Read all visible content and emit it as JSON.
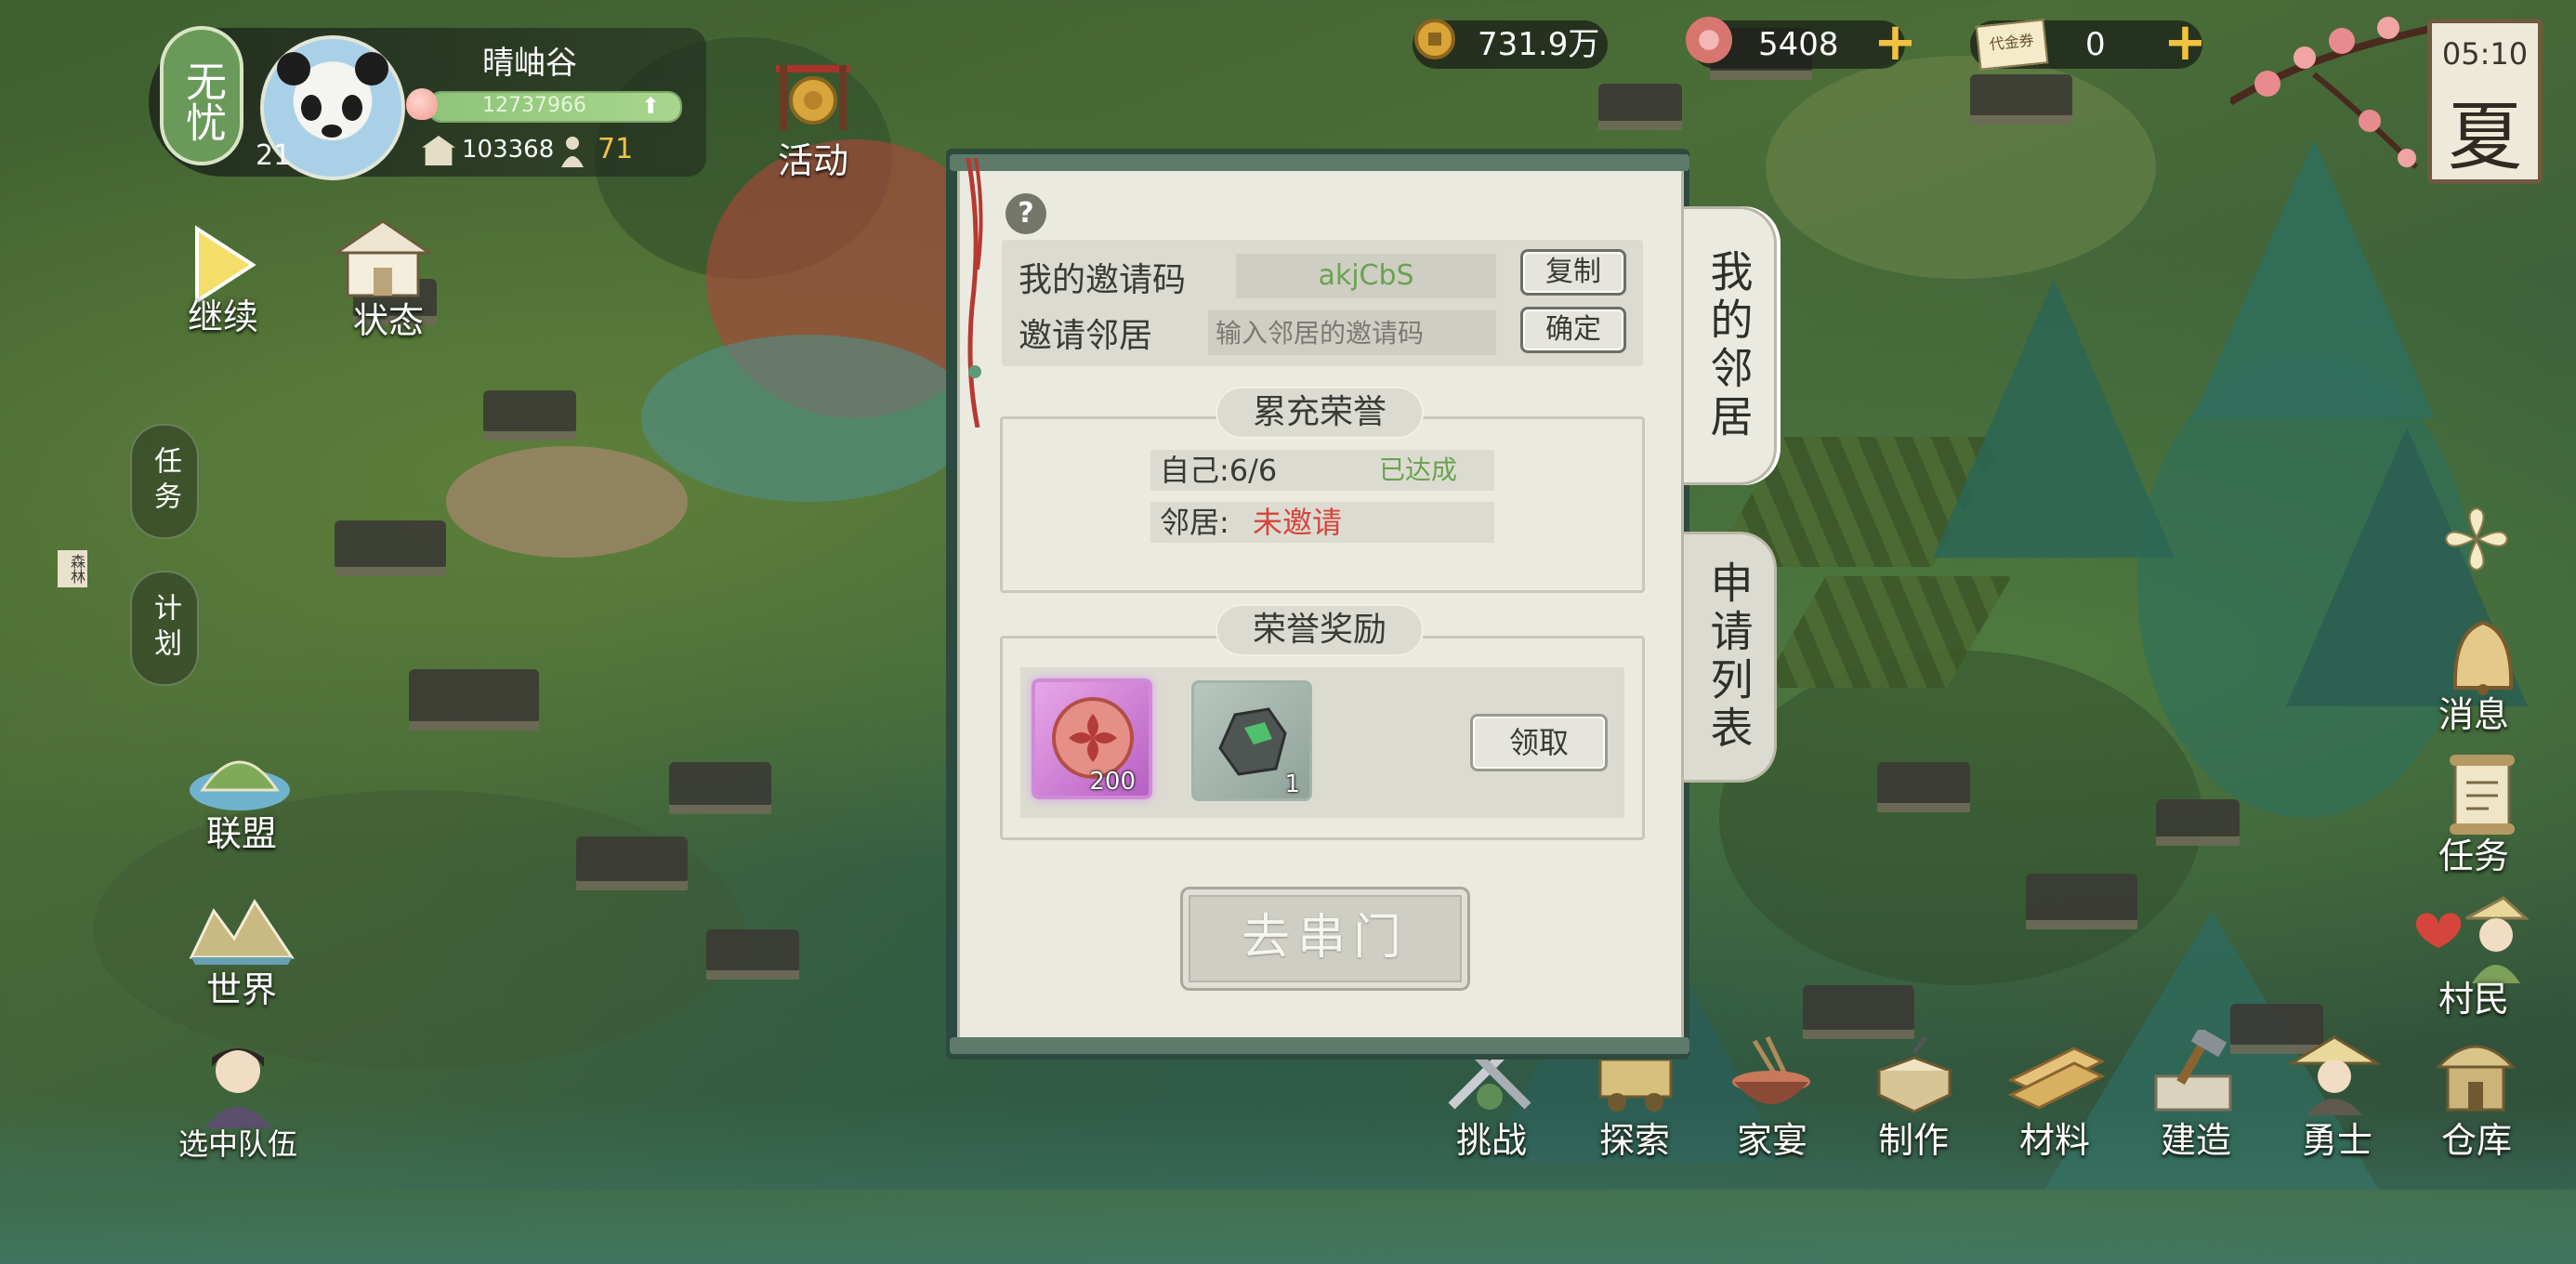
{
  "player": {
    "status": "无忧",
    "name": "晴岫谷",
    "exp": "12737966",
    "level": "21",
    "prosperity": "103368",
    "population": "71"
  },
  "resources": {
    "coins": "731.9万",
    "flower": "5408",
    "voucher_label": "代金券",
    "voucher": "0"
  },
  "clock": {
    "time": "05:10",
    "season": "夏"
  },
  "activity": {
    "label": "活动"
  },
  "left_menu": {
    "continue": "继续",
    "status": "状态",
    "tasks_tab": "任务",
    "plan_tab": "计划",
    "forest_tag": "森林",
    "alliance": "联盟",
    "world": "世界",
    "team": "选中队伍"
  },
  "right_menu": {
    "messages": "消息",
    "tasks": "任务",
    "villagers": "村民"
  },
  "bottom_menu": [
    {
      "label": "挑战",
      "icon": "swords-icon"
    },
    {
      "label": "探索",
      "icon": "explore-icon"
    },
    {
      "label": "家宴",
      "icon": "feast-icon"
    },
    {
      "label": "制作",
      "icon": "craft-icon"
    },
    {
      "label": "材料",
      "icon": "lumber-icon"
    },
    {
      "label": "建造",
      "icon": "build-icon"
    },
    {
      "label": "勇士",
      "icon": "warrior-icon"
    },
    {
      "label": "仓库",
      "icon": "warehouse-icon"
    }
  ],
  "dialog": {
    "my_code_label": "我的邀请码",
    "my_code": "akjCbS",
    "copy": "复制",
    "invite_label": "邀请邻居",
    "invite_placeholder": "输入邻居的邀请码",
    "confirm": "确定",
    "honor_title": "累充荣誉",
    "self_label": "自己:6/6",
    "self_status": "已达成",
    "neighbor_label": "邻居:",
    "neighbor_status": "未邀请",
    "reward_title": "荣誉奖励",
    "rewards": [
      {
        "name": "flower-token",
        "count": "200"
      },
      {
        "name": "jade-ore",
        "count": "1"
      }
    ],
    "claim": "领取",
    "visit": "去串门",
    "tab_neighbors": "我的邻居",
    "tab_requests": "申请列表"
  },
  "colors": {
    "accent_green": "#6aa34f",
    "warning_red": "#d6453b",
    "gold": "#f3c23e"
  }
}
